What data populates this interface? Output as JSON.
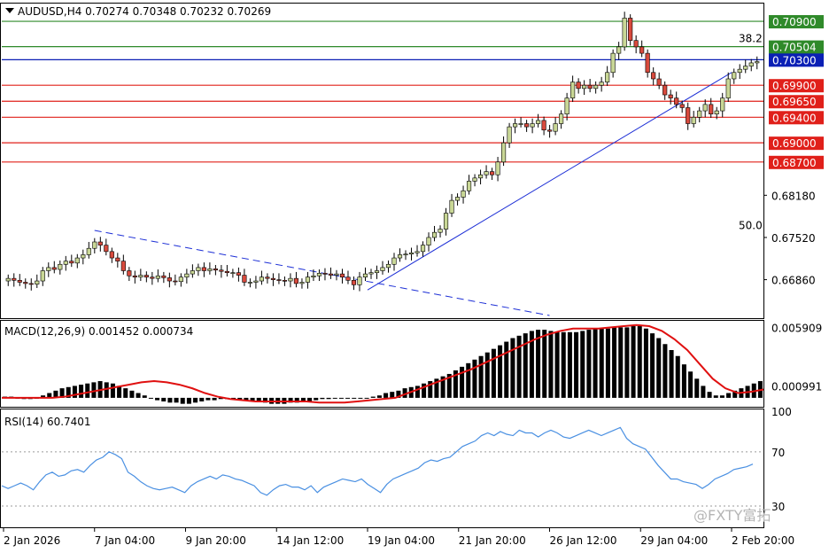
{
  "header": {
    "symbol_line": "AUDUSD,H4  0.70274 0.70348 0.70232 0.70269"
  },
  "watermark": "@FXTY富拓",
  "colors": {
    "up_candle": "#c9d796",
    "down_candle": "#d84a3d",
    "support_line": "#e0201a",
    "resistance_line": "#2f8a2a",
    "current_price": "#0a1fb5",
    "macd_signal": "#e01010",
    "rsi_line": "#4a90e2"
  },
  "chart_data": [
    {
      "type": "candlestick",
      "title": "AUDUSD,H4",
      "ohlc_header": {
        "open": 0.70274,
        "high": 0.70348,
        "low": 0.70232,
        "close": 0.70269
      },
      "ylim": [
        0.663,
        0.7115
      ],
      "y_ticks": [
        "0.68180",
        "0.67520",
        "0.66860"
      ],
      "x_ticks": [
        "2 Jan 2026",
        "7 Jan 04:00",
        "9 Jan 20:00",
        "14 Jan 12:00",
        "19 Jan 04:00",
        "21 Jan 20:00",
        "26 Jan 12:00",
        "29 Jan 04:00",
        "2 Feb 20:00"
      ],
      "levels": [
        {
          "price": 0.709,
          "label": "0.70900",
          "kind": "resistance"
        },
        {
          "price": 0.70504,
          "label": "0.70504",
          "kind": "resistance"
        },
        {
          "price": 0.703,
          "label": "0.70300",
          "kind": "current"
        },
        {
          "price": 0.699,
          "label": "0.69900",
          "kind": "support"
        },
        {
          "price": 0.6965,
          "label": "0.69650",
          "kind": "support"
        },
        {
          "price": 0.694,
          "label": "0.69400",
          "kind": "support"
        },
        {
          "price": 0.69,
          "label": "0.69000",
          "kind": "support"
        },
        {
          "price": 0.687,
          "label": "0.68700",
          "kind": "support"
        }
      ],
      "fib_labels": [
        {
          "text": "38.2",
          "price": 0.70504
        },
        {
          "text": "50.0",
          "price": 0.6758
        }
      ],
      "trendlines": [
        {
          "style": "solid",
          "from": {
            "x": "19 Jan 04:00",
            "price": 0.667
          },
          "to": {
            "x": "2 Feb 20:00",
            "price": 0.701
          }
        },
        {
          "style": "dashed",
          "from": {
            "x": "7 Jan 04:00",
            "price": 0.6763
          },
          "to": {
            "x": "26 Jan 12:00",
            "price": 0.663
          }
        }
      ],
      "close_path": [
        0.6688,
        0.6685,
        0.6682,
        0.668,
        0.6679,
        0.6684,
        0.67,
        0.6705,
        0.6702,
        0.671,
        0.6715,
        0.6712,
        0.672,
        0.6725,
        0.6735,
        0.6745,
        0.674,
        0.673,
        0.672,
        0.6715,
        0.67,
        0.6692,
        0.669,
        0.6693,
        0.669,
        0.6688,
        0.6692,
        0.6689,
        0.6684,
        0.6683,
        0.669,
        0.6695,
        0.67,
        0.6705,
        0.67,
        0.6703,
        0.6701,
        0.6699,
        0.6697,
        0.6697,
        0.6693,
        0.6682,
        0.6682,
        0.6684,
        0.669,
        0.6688,
        0.6686,
        0.6685,
        0.6684,
        0.6688,
        0.668,
        0.6682,
        0.669,
        0.6692,
        0.6696,
        0.6695,
        0.6693,
        0.6695,
        0.669,
        0.6685,
        0.6678,
        0.669,
        0.6695,
        0.6697,
        0.67,
        0.6705,
        0.671,
        0.672,
        0.6725,
        0.6726,
        0.6728,
        0.673,
        0.674,
        0.6752,
        0.676,
        0.6765,
        0.679,
        0.681,
        0.6815,
        0.6825,
        0.684,
        0.6845,
        0.685,
        0.6855,
        0.685,
        0.687,
        0.69,
        0.6925,
        0.693,
        0.693,
        0.6925,
        0.693,
        0.6935,
        0.692,
        0.6918,
        0.693,
        0.6945,
        0.697,
        0.6995,
        0.6985,
        0.699,
        0.6985,
        0.699,
        0.6995,
        0.701,
        0.704,
        0.705,
        0.7095,
        0.706,
        0.705,
        0.704,
        0.701,
        0.7,
        0.699,
        0.6975,
        0.697,
        0.696,
        0.6955,
        0.693,
        0.694,
        0.695,
        0.696,
        0.6945,
        0.695,
        0.697,
        0.7,
        0.701,
        0.7015,
        0.702,
        0.7025,
        0.7027
      ]
    },
    {
      "type": "bar",
      "title": "MACD(12,26,9) 0.001452 0.000734",
      "main": 0.001452,
      "signal": 0.000734,
      "ylim": [
        -0.0006,
        0.0063
      ],
      "y_ticks": [
        "0.005909",
        "0.000991"
      ],
      "histogram": [
        0.0001,
        0.0001,
        0.0,
        -0.0001,
        -0.0001,
        0.0,
        0.0002,
        0.0004,
        0.0006,
        0.0008,
        0.0009,
        0.001,
        0.0011,
        0.0012,
        0.0013,
        0.0014,
        0.0013,
        0.0012,
        0.001,
        0.0008,
        0.0006,
        0.0004,
        0.0002,
        0.0,
        -0.0002,
        -0.0003,
        -0.0004,
        -0.0004,
        -0.0005,
        -0.0005,
        -0.0004,
        -0.0003,
        -0.0002,
        -0.0002,
        -0.0001,
        -0.0001,
        -0.0001,
        -0.0002,
        -0.0002,
        -0.0003,
        -0.0003,
        -0.0004,
        -0.0005,
        -0.0005,
        -0.0005,
        -0.0004,
        -0.0004,
        -0.0003,
        -0.0003,
        -0.0002,
        -0.0001,
        -0.0001,
        0.0,
        0.0,
        0.0,
        0.0,
        0.0,
        0.0,
        0.0001,
        0.0002,
        0.0004,
        0.0005,
        0.0006,
        0.0008,
        0.0009,
        0.001,
        0.0012,
        0.0014,
        0.0016,
        0.0018,
        0.002,
        0.0023,
        0.0026,
        0.0029,
        0.0032,
        0.0035,
        0.0038,
        0.0041,
        0.0044,
        0.0047,
        0.005,
        0.0052,
        0.0054,
        0.0056,
        0.0057,
        0.0057,
        0.0056,
        0.0055,
        0.0055,
        0.0055,
        0.0055,
        0.0056,
        0.0057,
        0.0058,
        0.0058,
        0.0058,
        0.0059,
        0.0059,
        0.0059,
        0.006,
        0.006,
        0.0058,
        0.0054,
        0.005,
        0.0045,
        0.004,
        0.0035,
        0.0028,
        0.0022,
        0.0016,
        0.001,
        0.0005,
        0.0002,
        0.0002,
        0.0004,
        0.0006,
        0.0008,
        0.001,
        0.0012,
        0.0014
      ],
      "signal_path": [
        0.0,
        0.0,
        0.0,
        0.0,
        0.0,
        0.0001,
        0.0003,
        0.0005,
        0.0007,
        0.0009,
        0.0011,
        0.0013,
        0.0014,
        0.0013,
        0.0011,
        0.0008,
        0.0004,
        0.0001,
        -0.0001,
        -0.0002,
        -0.0003,
        -0.0003,
        -0.0003,
        -0.0003,
        -0.0003,
        -0.0004,
        -0.0004,
        -0.0004,
        -0.0003,
        -0.0002,
        -0.0001,
        0.0,
        0.0004,
        0.0008,
        0.0012,
        0.0016,
        0.002,
        0.0024,
        0.0029,
        0.0034,
        0.0039,
        0.0044,
        0.0049,
        0.0053,
        0.0056,
        0.0058,
        0.0058,
        0.0058,
        0.0059,
        0.006,
        0.0061,
        0.006,
        0.0056,
        0.0049,
        0.004,
        0.0028,
        0.0016,
        0.0008,
        0.0004,
        0.0005,
        0.0007
      ]
    },
    {
      "type": "line",
      "title": "RSI(14) 60.7401",
      "value": 60.7401,
      "ylim": [
        15,
        100
      ],
      "y_ticks": [
        "100",
        "70",
        "30"
      ],
      "levels": [
        70,
        30
      ],
      "values": [
        45,
        43,
        45,
        47,
        45,
        42,
        48,
        53,
        55,
        52,
        53,
        56,
        57,
        55,
        60,
        64,
        66,
        70,
        68,
        65,
        55,
        52,
        48,
        45,
        43,
        42,
        43,
        44,
        42,
        40,
        45,
        48,
        50,
        52,
        50,
        53,
        52,
        50,
        49,
        47,
        45,
        40,
        38,
        42,
        45,
        46,
        44,
        44,
        42,
        45,
        40,
        44,
        46,
        48,
        50,
        49,
        48,
        50,
        46,
        43,
        40,
        46,
        50,
        52,
        54,
        56,
        58,
        62,
        64,
        63,
        65,
        66,
        70,
        74,
        76,
        78,
        82,
        84,
        82,
        85,
        83,
        82,
        86,
        84,
        84,
        81,
        84,
        86,
        84,
        81,
        80,
        82,
        84,
        86,
        84,
        82,
        84,
        86,
        88,
        80,
        76,
        74,
        72,
        66,
        60,
        55,
        50,
        50,
        48,
        47,
        46,
        43,
        46,
        50,
        52,
        54,
        57,
        58,
        59,
        61
      ]
    }
  ]
}
